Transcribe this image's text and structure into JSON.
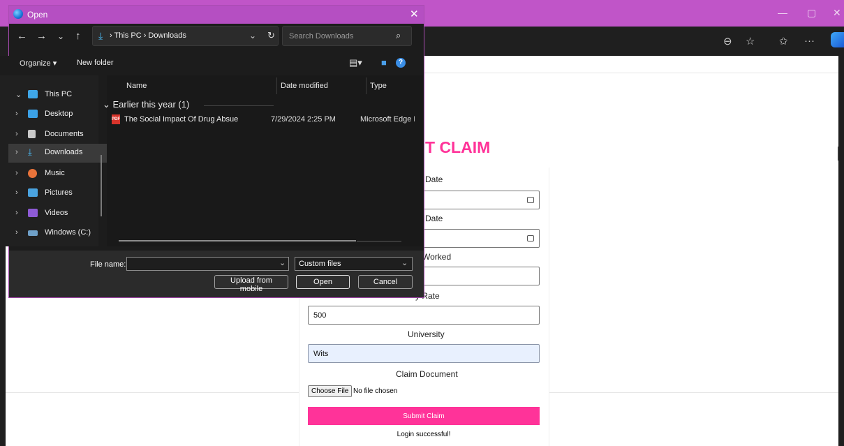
{
  "page": {
    "heading": "T CLAIM",
    "form": {
      "start_date_label": "Date",
      "end_date_label": "Date",
      "hours_label": "Worked",
      "rate_label": "y Rate",
      "rate_value": "500",
      "university_label": "University",
      "university_value": "Wits",
      "document_label": "Claim Document",
      "choose_file_label": "Choose File",
      "file_status": "No file chosen",
      "submit_label": "Submit Claim"
    },
    "status_message": "Login successful!"
  },
  "dialog": {
    "title": "Open",
    "address": {
      "path": "› This PC › Downloads"
    },
    "search_placeholder": "Search Downloads",
    "commands": {
      "organize": "Organize ▾",
      "new_folder": "New folder"
    },
    "nav_items": [
      {
        "label": "This PC",
        "color": "#3fa7e8"
      },
      {
        "label": "Desktop",
        "color": "#3ba1e6"
      },
      {
        "label": "Documents",
        "color": "#c9c9c9"
      },
      {
        "label": "Downloads",
        "color": "#4cc2ff"
      },
      {
        "label": "Music",
        "color": "#e8733a"
      },
      {
        "label": "Pictures",
        "color": "#4aa3df"
      },
      {
        "label": "Videos",
        "color": "#8e5bd6"
      },
      {
        "label": "Windows (C:)",
        "color": "#6fa0c8"
      }
    ],
    "columns": {
      "name": "Name",
      "date_modified": "Date modified",
      "type": "Type"
    },
    "group": "Earlier this year (1)",
    "files": [
      {
        "name": "The Social Impact Of Drug Absue",
        "date": "7/29/2024 2:25 PM",
        "type": "Microsoft Edge PDF Document"
      }
    ],
    "file_name_label": "File name:",
    "file_name_value": "",
    "file_type": "Custom files",
    "buttons": {
      "upload": "Upload from mobile",
      "open": "Open",
      "cancel": "Cancel"
    }
  },
  "colors": {
    "accent_pink": "#ff3399",
    "dialog_title_purple": "#b54fc2"
  }
}
